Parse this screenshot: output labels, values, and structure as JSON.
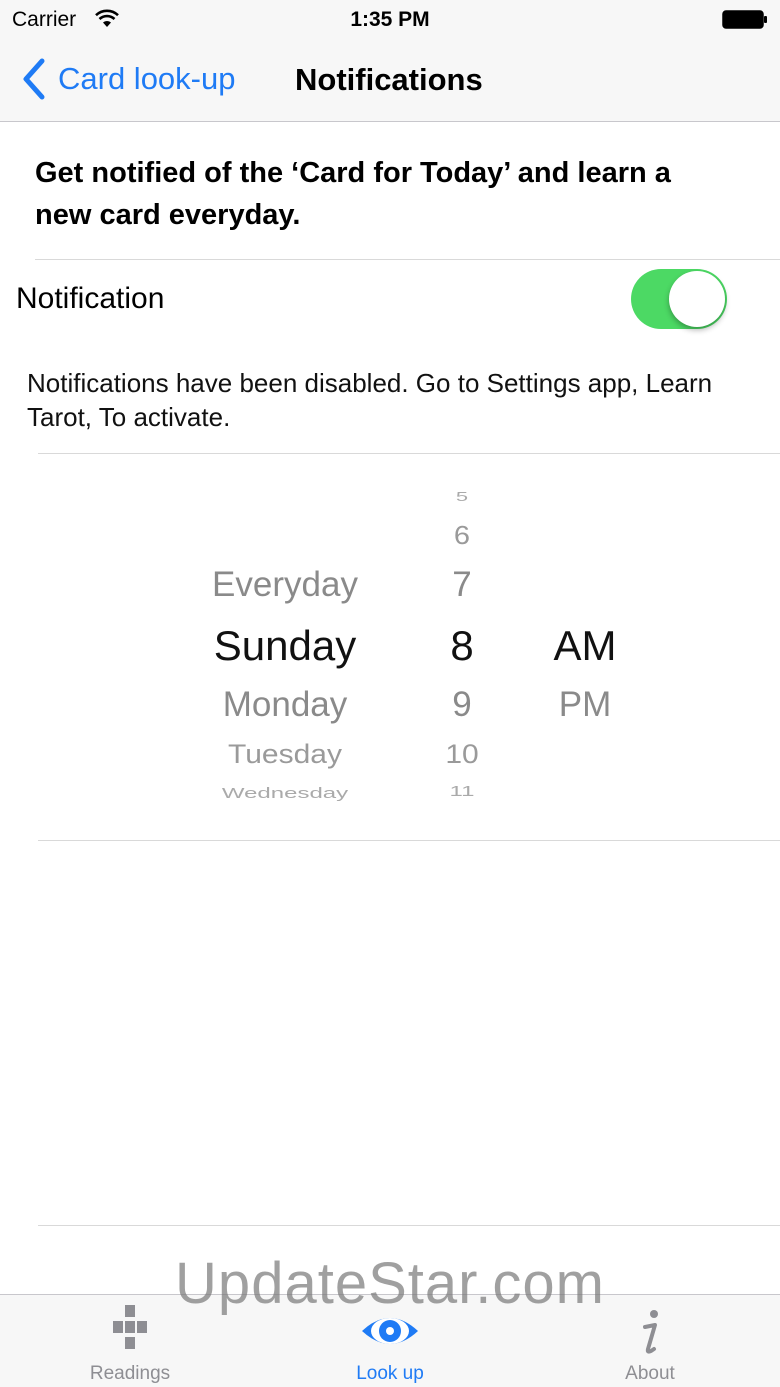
{
  "status": {
    "carrier": "Carrier",
    "time": "1:35 PM"
  },
  "nav": {
    "back_label": "Card look-up",
    "title": "Notifications"
  },
  "intro": {
    "text": "Get notified of the ‘Card for Today’ and learn a new card everyday."
  },
  "notification": {
    "label": "Notification",
    "enabled": true,
    "accent_color": "#4cd964"
  },
  "disabled_notice": {
    "text": "Notifications have been disabled. Go to Settings app, Learn Tarot, To activate."
  },
  "picker": {
    "days": [
      "Everyday",
      "Sunday",
      "Monday",
      "Tuesday",
      "Wednesday"
    ],
    "selected_day": "Sunday",
    "hours": [
      "5",
      "6",
      "7",
      "8",
      "9",
      "10",
      "11"
    ],
    "selected_hour": "8",
    "ampm": [
      "AM",
      "PM"
    ],
    "selected_ampm": "AM"
  },
  "tabs": [
    {
      "label": "Readings",
      "icon": "readings-grid-icon",
      "active": false
    },
    {
      "label": "Look up",
      "icon": "eye-icon",
      "active": true
    },
    {
      "label": "About",
      "icon": "info-icon",
      "active": false
    }
  ],
  "watermark": "UpdateStar.com",
  "colors": {
    "tint": "#1f7bf5",
    "inactive": "#8e8e93"
  }
}
